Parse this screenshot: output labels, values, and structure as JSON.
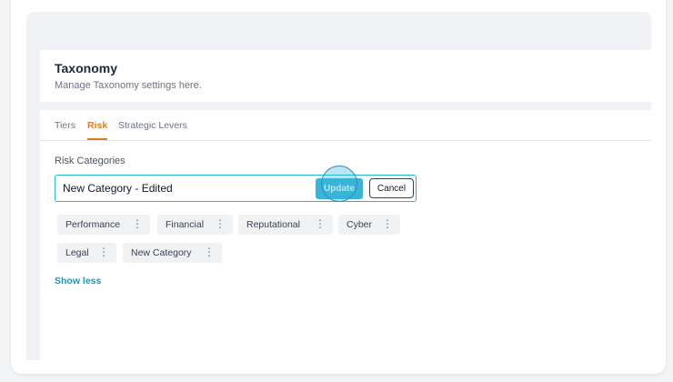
{
  "header": {
    "title": "Taxonomy",
    "subtitle": "Manage Taxonomy settings here."
  },
  "tabs": [
    {
      "label": "Tiers",
      "active": false
    },
    {
      "label": "Risk",
      "active": true
    },
    {
      "label": "Strategic Levers",
      "active": false
    }
  ],
  "risk_categories": {
    "section_label": "Risk Categories",
    "edit_value": "New Category - Edited",
    "update_label": "Update",
    "cancel_label": "Cancel",
    "chips": [
      {
        "label": "Performance"
      },
      {
        "label": "Financial"
      },
      {
        "label": "Reputational"
      },
      {
        "label": "Cyber"
      },
      {
        "label": "Legal"
      },
      {
        "label": "New Category"
      }
    ],
    "show_less_label": "Show less",
    "kebab_glyph": "⋮"
  },
  "colors": {
    "accent_tab": "#e07a1c",
    "focus_border": "#22b8cf",
    "update_button": "#3ab4d8",
    "link": "#1a97b8"
  },
  "icons": {
    "chip_menu": "kebab-menu-icon"
  }
}
